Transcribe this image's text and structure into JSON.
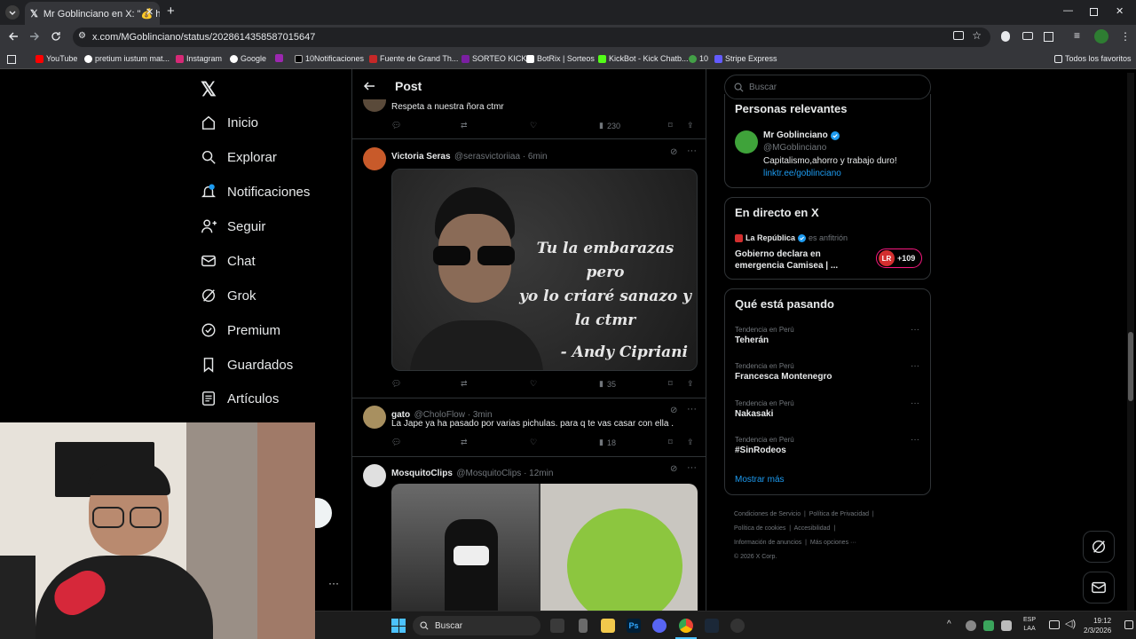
{
  "browser": {
    "tab_title": "Mr Goblinciano en X: \"💰 https:",
    "url": "x.com/MGoblinciano/status/2028614358587015647",
    "bookmarks": [
      "YouTube",
      "pretium iustum mat...",
      "Instagram",
      "Google",
      "",
      "10Notificaciones",
      "Fuente de Grand Th...",
      "SORTEO KICK",
      "BotRix | Sorteos",
      "KickBot - Kick Chatb...",
      "10",
      "Stripe Express"
    ],
    "bookmarks_right": "Todos los favoritos"
  },
  "nav": {
    "logo": "X",
    "items": [
      "Inicio",
      "Explorar",
      "Notificaciones",
      "Seguir",
      "Chat",
      "Grok",
      "Premium",
      "Guardados",
      "Artículos"
    ],
    "notif_badge": "",
    "more": "···"
  },
  "header": {
    "title": "Post"
  },
  "tweets": [
    {
      "text": "Respeta a nuestra ñora ctmr",
      "views": "230"
    },
    {
      "name": "Victoria Seras",
      "handle": "@serasvictoriiaa · 6min",
      "image_lines": [
        "Tu la embarazas pero",
        "yo lo criaré sanazo y",
        "la ctmr"
      ],
      "image_sig": "- Andy Cipriani",
      "views": "35"
    },
    {
      "name": "gato",
      "handle": "@CholoFlow · 3min",
      "text": "La Jape ya ha pasado por varias pichulas. para q te vas casar con ella .",
      "views": "18"
    },
    {
      "name": "MosquitoClips",
      "handle": "@MosquitoClips · 12min"
    }
  ],
  "search": {
    "placeholder": "Buscar"
  },
  "relevant": {
    "title": "Personas relevantes",
    "name": "Mr Goblinciano",
    "handle": "@MGoblinciano",
    "bio": "Capitalismo,ahorro y trabajo duro!",
    "link": "linktr.ee/goblinciano"
  },
  "live": {
    "title": "En directo en X",
    "host": "La República",
    "host_note": "es anfitrión",
    "headline": "Gobierno declara en emergencia Camisea | ...",
    "badge": "LR",
    "count": "+109"
  },
  "trends": {
    "title": "Qué está pasando",
    "items": [
      {
        "sub": "Tendencia en Perú",
        "name": "Teherán"
      },
      {
        "sub": "Tendencia en Perú",
        "name": "Francesca Montenegro"
      },
      {
        "sub": "Tendencia en Perú",
        "name": "Nakasaki"
      },
      {
        "sub": "Tendencia en Perú",
        "name": "#SinRodeos"
      }
    ],
    "more": "Mostrar más"
  },
  "footer": {
    "l1a": "Condiciones de Servicio",
    "l1b": "Política de Privacidad",
    "l2a": "Política de cookies",
    "l2b": "Accesibilidad",
    "l3a": "Información de anuncios",
    "l3b": "Más opciones ···",
    "copy": "© 2026 X Corp."
  },
  "taskbar": {
    "search": "Buscar",
    "lang1": "ESP",
    "lang2": "LAA",
    "time": "19:12",
    "date": "2/3/2026"
  },
  "colors": {
    "accent": "#1d9bf0",
    "bg": "#000000",
    "border": "#2f3336",
    "muted": "#71767b"
  }
}
